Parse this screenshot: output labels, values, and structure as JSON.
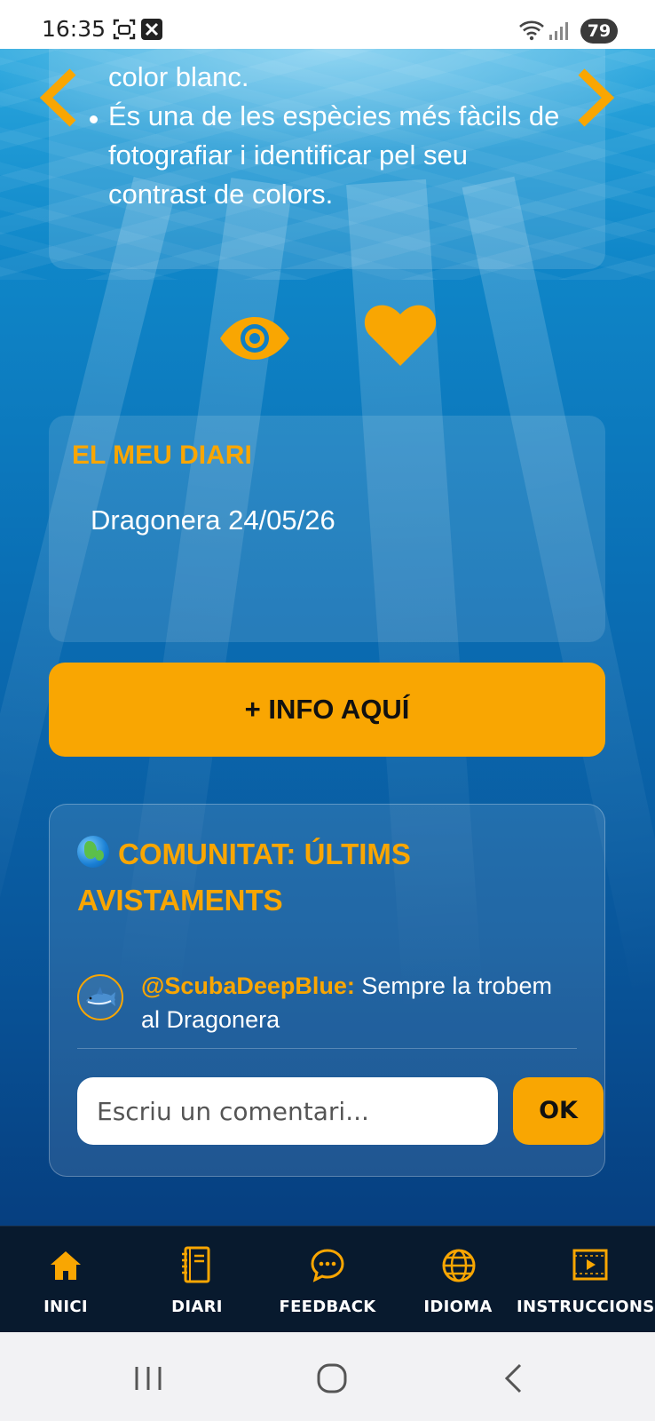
{
  "status_bar": {
    "time": "16:35",
    "battery": "79",
    "icons": [
      "screenshot-icon",
      "close-box-icon",
      "wifi-icon",
      "signal-icon"
    ]
  },
  "species_info": {
    "lines": [
      "color blanc.",
      "És una de les espècies més fàcils de",
      "fotografiar i identificar pel seu",
      "contrast de colors."
    ],
    "prev_icon": "chevron-left-icon",
    "next_icon": "chevron-right-icon"
  },
  "actions": {
    "view_icon": "eye-icon",
    "favorite_icon": "heart-icon"
  },
  "diary": {
    "title": "EL MEU DIARI",
    "entry": "Dragonera 24/05/26"
  },
  "info_button": {
    "label": "+ INFO AQUÍ"
  },
  "community": {
    "title": "COMUNITAT: ÚLTIMS AVISTAMENTS",
    "title_icon": "globe-icon",
    "comments": [
      {
        "user": "@ScubaDeepBlue:",
        "text": " Sempre la trobem al Dragonera",
        "avatar_icon": "shark-icon"
      }
    ],
    "input_placeholder": "Escriu un comentari...",
    "submit_label": "OK"
  },
  "bottom_nav": {
    "items": [
      {
        "label": "INICI",
        "icon": "home-icon"
      },
      {
        "label": "DIARI",
        "icon": "notebook-icon"
      },
      {
        "label": "FEEDBACK",
        "icon": "chat-icon"
      },
      {
        "label": "IDIOMA",
        "icon": "globe-icon"
      },
      {
        "label": "INSTRUCCIONS",
        "icon": "video-icon"
      }
    ]
  },
  "system_nav": {
    "icons": [
      "recents-icon",
      "home-circle-icon",
      "back-icon"
    ]
  },
  "colors": {
    "accent": "#f9a602",
    "nav_background": "#081a2e",
    "ocean_top": "#2aa7de",
    "ocean_bottom": "#063f80"
  }
}
